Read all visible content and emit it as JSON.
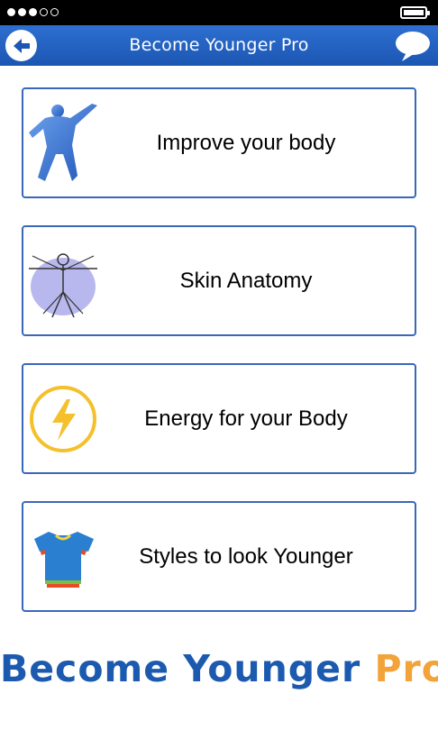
{
  "status_bar": {
    "signal_dots_filled": 3,
    "signal_dots_total": 5,
    "battery_level_percent": 100
  },
  "app_bar": {
    "title": "Become Younger Pro",
    "back_icon": "back-arrow-icon",
    "chat_icon": "chat-bubble-icon"
  },
  "menu": {
    "items": [
      {
        "label": "Improve your body",
        "icon": "muscle-man-icon"
      },
      {
        "label": "Skin Anatomy",
        "icon": "vitruvian-man-icon"
      },
      {
        "label": "Energy for your Body",
        "icon": "lightning-bolt-icon"
      },
      {
        "label": "Styles to look Younger",
        "icon": "tshirts-icon"
      }
    ]
  },
  "footer": {
    "brand_main": "Become Younger",
    "brand_pro": "Pro"
  },
  "colors": {
    "app_bar": "#1d56b3",
    "card_border": "#3a68b8",
    "brand_blue": "#1b5aaf",
    "brand_orange": "#f2a33a"
  }
}
